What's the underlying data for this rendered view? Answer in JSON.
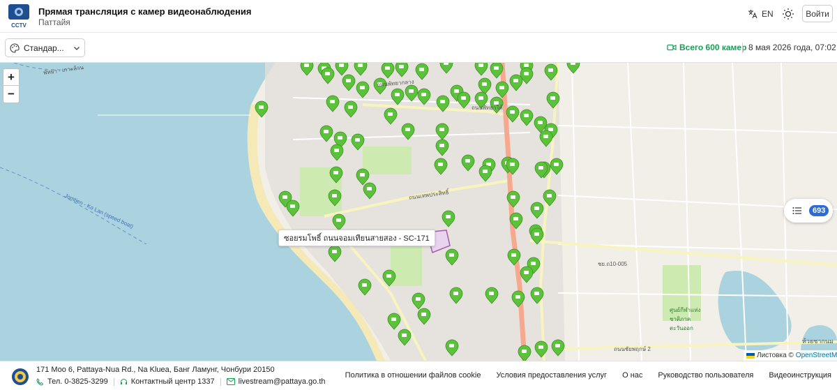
{
  "header": {
    "title": "Прямая трансляция с камер видеонаблюдения",
    "subtitle": "Паттайя",
    "logo_text": "CCTV",
    "lang_label": "EN",
    "login_label": "Войти"
  },
  "toolbar": {
    "map_style_label": "Стандар...",
    "camera_count_label": "Всего 600 камер",
    "datetime": "8 мая 2026 года, 07:02"
  },
  "map": {
    "zoom_in_label": "+",
    "zoom_out_label": "−",
    "tooltip": "ซอยรมโพธิ์ ถนนจอมเทียนสายสอง - SC-171",
    "list_count": "693",
    "attribution_prefix": "Листовка ©",
    "attribution_source": "OpenStreetMap",
    "labels": {
      "ferry": "Jomtien - Ko Lan (speed boat)",
      "road_a": "ถนนเทพประสิทธิ์",
      "road_b": "ถนนพัทยาใต้",
      "road_c": "ถนนพัทยากลาง",
      "road_d": "ชย.ถ10-005",
      "road_e": "ถนนชัยพฤกษ์ 2",
      "lake": "ห้วยชากนม",
      "hospital": "ศูนย์กีฬาแห่งชาติภาคตะวันออก",
      "sea_route": "พัทยา - เกาะล้าน"
    },
    "colors": {
      "sea": "#aad3df",
      "land": "#f2efe9",
      "marker": "#5cc23b",
      "main_road": "#f6a98f",
      "minor_road": "#f7f4c0"
    }
  },
  "footer": {
    "address": "171 Moo 6, Pattaya-Nua Rd., Na Kluea, Банг Ламунг, Чонбури 20150",
    "phone": "Тел. 0-3825-3299",
    "contact_center": "Контактный центр 1337",
    "email": "livestream@pattaya.go.th",
    "links": [
      "Политика в отношении файлов cookie",
      "Условия предоставления услуг",
      "О нас",
      "Руководство пользователя",
      "Видеоинструкция"
    ]
  }
}
